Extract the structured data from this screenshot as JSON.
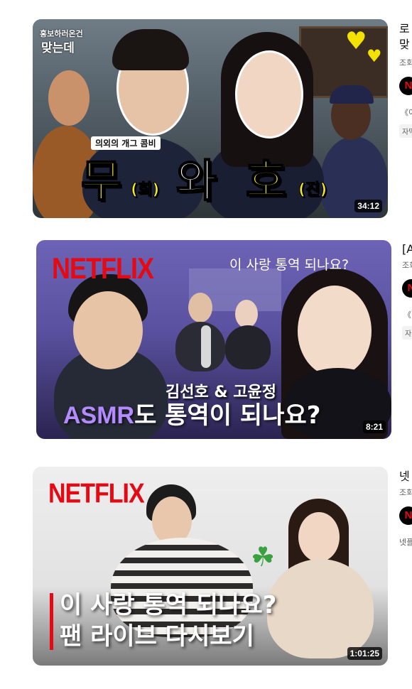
{
  "videos": [
    {
      "duration": "34:12",
      "title_line1": "로",
      "title_line2": "맞",
      "views": "조회",
      "avatar": "N",
      "desc": "《이",
      "badge": "자막",
      "thumb_text": {
        "logo_line1": "홍보하러온건",
        "logo_line2": "맞는데",
        "caption": "의외의 개그 콤비",
        "big1": "무",
        "small1": "(희)",
        "big2": "와",
        "big3": "호",
        "small2": "(진)"
      }
    },
    {
      "duration": "8:21",
      "title_line1": "[A",
      "views": "조회",
      "avatar": "N",
      "desc": "《",
      "badge": "자",
      "thumb_text": {
        "logo": "NETFLIX",
        "question": "이 사랑 통역 되나요?",
        "names": "김선호 & 고윤정",
        "headline_latin": "ASMR",
        "headline_korean": "도 통역이 되나요?"
      }
    },
    {
      "duration": "1:01:25",
      "title_line1": "넷",
      "views": "조회",
      "avatar": "N",
      "desc": "넷플",
      "thumb_text": {
        "logo": "NETFLIX",
        "line1": "이 사랑 통역 되나요?",
        "line2": "팬 라이브 다시보기"
      }
    }
  ]
}
